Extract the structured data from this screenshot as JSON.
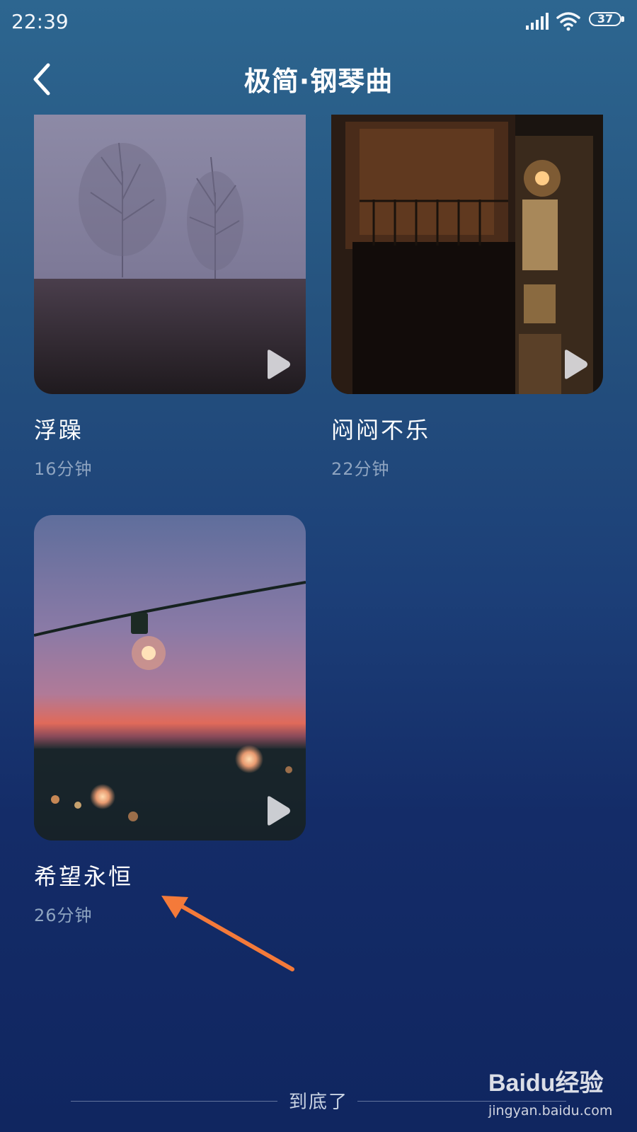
{
  "status_bar": {
    "time": "22:39",
    "battery_level": "37",
    "icons": [
      "signal-icon",
      "wifi-icon",
      "battery-icon"
    ]
  },
  "header": {
    "back_icon": "chevron-left-icon",
    "title": "极简·钢琴曲"
  },
  "tracks": [
    {
      "title": "浮躁",
      "duration": "16分钟",
      "thumbnail": "foggy-trees"
    },
    {
      "title": "闷闷不乐",
      "duration": "22分钟",
      "thumbnail": "night-house"
    },
    {
      "title": "希望永恒",
      "duration": "26分钟",
      "thumbnail": "sunset-lightbulbs"
    }
  ],
  "footer": {
    "end_text": "到底了"
  },
  "watermark": {
    "brand": "Baidu经验",
    "url": "jingyan.baidu.com"
  },
  "colors": {
    "background_top": "#2d6690",
    "background_bottom": "#102660",
    "duration_text": "#8ea4c0",
    "annotation_arrow": "#f47a3a"
  }
}
